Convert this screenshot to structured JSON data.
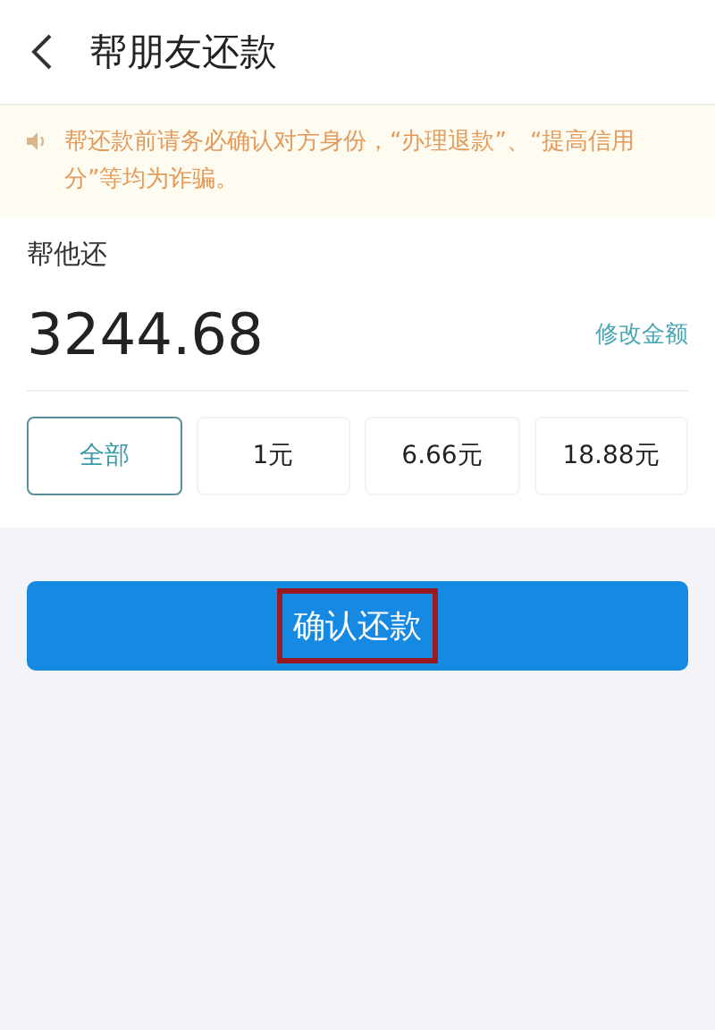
{
  "header": {
    "title": "帮朋友还款"
  },
  "notice": {
    "text": "帮还款前请务必确认对方身份，“办理退款”、“提高信用分”等均为诈骗。"
  },
  "amount": {
    "label": "帮他还",
    "value": "3244.68",
    "edit_link": "修改金额"
  },
  "options": [
    {
      "label": "全部",
      "selected": true
    },
    {
      "label": "1元",
      "selected": false
    },
    {
      "label": "6.66元",
      "selected": false
    },
    {
      "label": "18.88元",
      "selected": false
    }
  ],
  "confirm_button": {
    "label": "确认还款",
    "highlighted": true
  }
}
